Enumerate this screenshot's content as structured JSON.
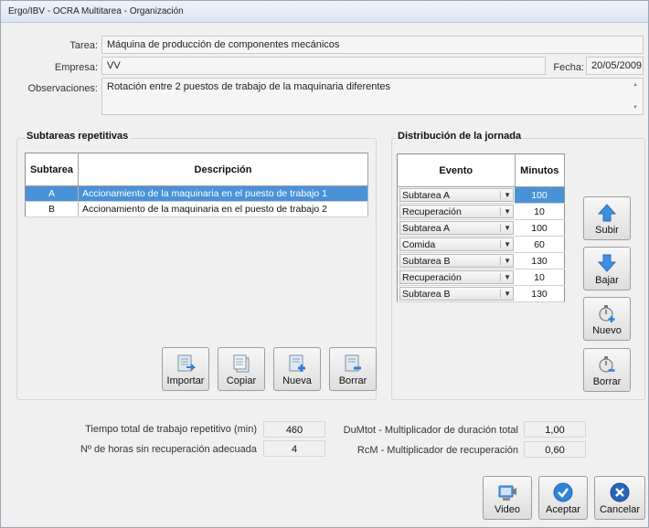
{
  "window": {
    "title": "Ergo/IBV - OCRA Multitarea - Organización"
  },
  "form": {
    "tarea_label": "Tarea:",
    "tarea_value": "Máquina de producción de componentes mecánicos",
    "empresa_label": "Empresa:",
    "empresa_value": "VV",
    "fecha_label": "Fecha:",
    "fecha_value": "20/05/2009",
    "obs_label": "Observaciones:",
    "obs_value": "Rotación entre 2 puestos de trabajo de la maquinaria diferentes"
  },
  "subtasks": {
    "title": "Subtareas repetitivas",
    "headers": [
      "Subtarea",
      "Descripción"
    ],
    "rows": [
      {
        "id": "A",
        "desc": "Accionamiento de la maquinaria en el puesto de trabajo 1"
      },
      {
        "id": "B",
        "desc": "Accionamiento de la maquinaria en el puesto de trabajo 2"
      }
    ],
    "buttons": {
      "importar": "Importar",
      "copiar": "Copiar",
      "nueva": "Nueva",
      "borrar": "Borrar"
    }
  },
  "distribution": {
    "title": "Distribución de la jornada",
    "headers": [
      "Evento",
      "Minutos"
    ],
    "rows": [
      {
        "evento": "Subtarea A",
        "minutos": "100"
      },
      {
        "evento": "Recuperación",
        "minutos": "10"
      },
      {
        "evento": "Subtarea A",
        "minutos": "100"
      },
      {
        "evento": "Comida",
        "minutos": "60"
      },
      {
        "evento": "Subtarea B",
        "minutos": "130"
      },
      {
        "evento": "Recuperación",
        "minutos": "10"
      },
      {
        "evento": "Subtarea B",
        "minutos": "130"
      }
    ],
    "buttons": {
      "subir": "Subir",
      "bajar": "Bajar",
      "nuevo": "Nuevo",
      "borrar": "Borrar"
    }
  },
  "summary": {
    "tiempo_label": "Tiempo total de trabajo repetitivo (min)",
    "tiempo_value": "460",
    "horas_label": "Nº de horas sin recuperación adecuada",
    "horas_value": "4",
    "dumtot_label": "DuMtot - Multiplicador de duración total",
    "dumtot_value": "1,00",
    "rcm_label": "RcM - Multiplicador de recuperación",
    "rcm_value": "0,60"
  },
  "actions": {
    "video": "Video",
    "aceptar": "Aceptar",
    "cancelar": "Cancelar"
  },
  "colors": {
    "selection": "#4a92d8",
    "accept": "#2f86d6",
    "cancel": "#2a63b8"
  }
}
